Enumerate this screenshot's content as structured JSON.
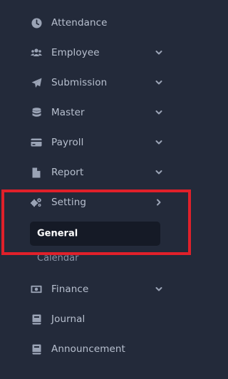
{
  "sidebar": {
    "items": [
      {
        "label": "Attendance",
        "icon": "clock-icon",
        "has_chevron": false
      },
      {
        "label": "Employee",
        "icon": "users-icon",
        "has_chevron": true
      },
      {
        "label": "Submission",
        "icon": "paper-plane-icon",
        "has_chevron": true
      },
      {
        "label": "Master",
        "icon": "database-icon",
        "has_chevron": true
      },
      {
        "label": "Payroll",
        "icon": "credit-card-icon",
        "has_chevron": true
      },
      {
        "label": "Report",
        "icon": "file-icon",
        "has_chevron": true
      },
      {
        "label": "Setting",
        "icon": "cogs-icon",
        "has_chevron": true,
        "expanded": true
      },
      {
        "label": "Finance",
        "icon": "money-bill-icon",
        "has_chevron": true
      },
      {
        "label": "Journal",
        "icon": "book-icon",
        "has_chevron": false
      },
      {
        "label": "Announcement",
        "icon": "book-icon",
        "has_chevron": false
      }
    ],
    "setting_submenu": {
      "active": "General",
      "items": [
        "General",
        "Calendar"
      ]
    }
  },
  "colors": {
    "background": "#232a3a",
    "label": "#b8c0cf",
    "icon": "#9aa3b5",
    "active_bg": "#151a26",
    "highlight": "#e0202a"
  }
}
